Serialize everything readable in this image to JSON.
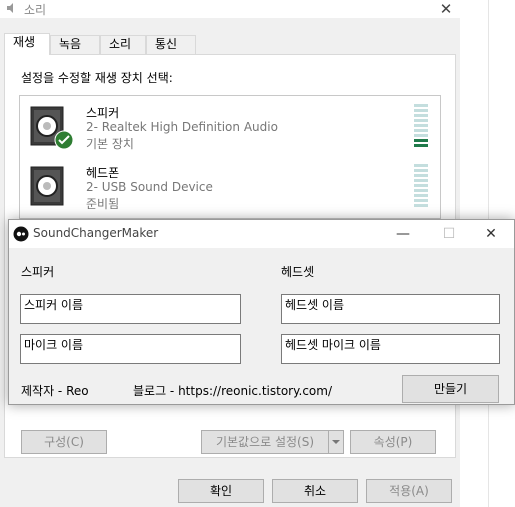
{
  "sound_dialog": {
    "title": "소리",
    "close_glyph": "✕",
    "tabs": [
      {
        "label": "재생"
      },
      {
        "label": "녹음"
      },
      {
        "label": "소리"
      },
      {
        "label": "통신"
      }
    ],
    "caption": "설정을 수정할 재생 장치 선택:",
    "devices": [
      {
        "name": "스피커",
        "driver": "2- Realtek High Definition Audio",
        "status": "기본 장치"
      },
      {
        "name": "헤드폰",
        "driver": "2- USB Sound Device",
        "status": "준비됨"
      }
    ],
    "buttons": {
      "configure": "구성(C)",
      "set_default": "기본값으로 설정(S)",
      "properties": "속성(P)",
      "ok": "확인",
      "cancel": "취소",
      "apply": "적용(A)"
    }
  },
  "scm": {
    "title": "SoundChangerMaker",
    "speaker_label": "스피커",
    "headset_label": "헤드셋",
    "speaker_name": "스피커 이름",
    "headset_name": "헤드셋 이름",
    "mic_name": "마이크 이름",
    "headset_mic_name": "헤드셋 마이크 이름",
    "author": "제작자 - Reo",
    "blog": "블로그 - https://reonic.tistory.com/",
    "make_button": "만들기",
    "minimize_glyph": "—",
    "maximize_glyph": "☐",
    "close_glyph": "✕"
  }
}
